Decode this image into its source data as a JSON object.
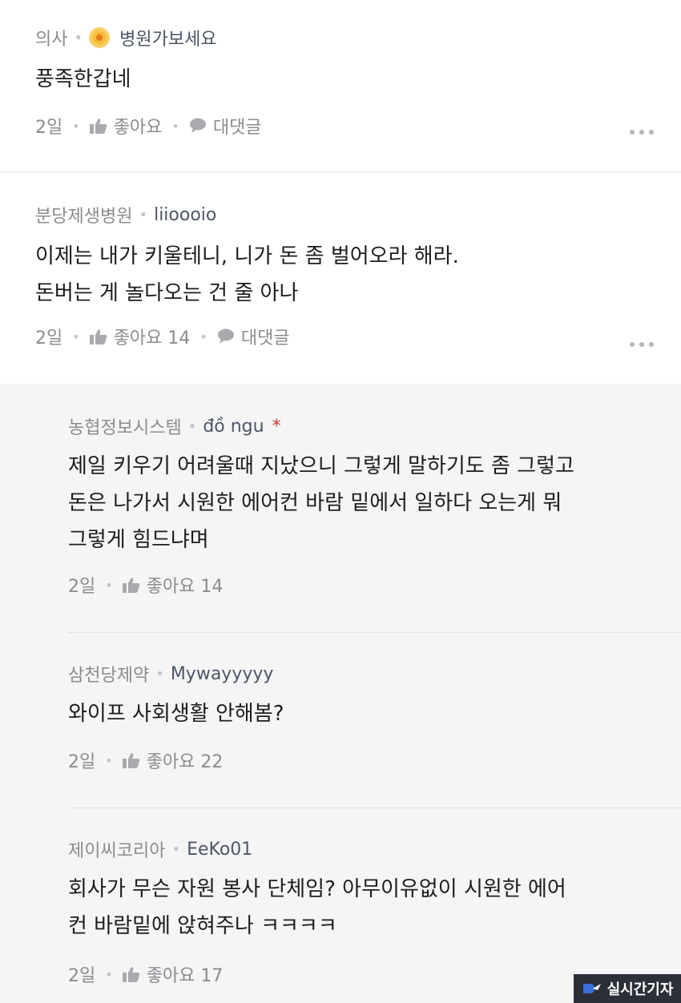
{
  "comments": [
    {
      "company": "의사",
      "nickname": "병원가보세요",
      "text_lines": [
        "풍족한갑네"
      ],
      "time": "2일",
      "like_label": "좋아요",
      "reply_label": "대댓글"
    },
    {
      "company": "분당제생병원",
      "nickname": "liioooio",
      "text_lines": [
        "이제는 내가 키울테니, 니가 돈 좀 벌어오라  해라.",
        "돈버는 게 놀다오는 건 줄 아나"
      ],
      "time": "2일",
      "like_label": "좋아요 14",
      "reply_label": "대댓글"
    }
  ],
  "replies": [
    {
      "company": "농협정보시스템",
      "nickname": "đồ ngu",
      "author_mark": "*",
      "text_lines": [
        "제일 키우기 어려울때 지났으니 그렇게 말하기도 좀 그렇고",
        "돈은 나가서 시원한 에어컨 바람 밑에서 일하다 오는게 뭐",
        "그렇게 힘드냐며"
      ],
      "time": "2일",
      "like_label": "좋아요 14"
    },
    {
      "company": "삼천당제약",
      "nickname": "Mywayyyyy",
      "text_lines": [
        "와이프 사회생활 안해봄?"
      ],
      "time": "2일",
      "like_label": "좋아요 22"
    },
    {
      "company": "제이씨코리아",
      "nickname": "EeKo01",
      "text_lines": [
        "회사가 무슨 자원 봉사 단체임? 아무이유없이 시원한 에어",
        "컨 바람밑에 앉혀주나 ㅋㅋㅋㅋ"
      ],
      "time": "2일",
      "like_label": "좋아요 17"
    }
  ],
  "icons": {
    "like": "thumbs-up-icon",
    "reply": "speech-bubble-icon",
    "more": "more-dots-icon",
    "badge": "sun-badge-icon"
  },
  "watermark": {
    "label": "실시간기자"
  },
  "colors": {
    "reply_background": "#f5f5f6",
    "author_mark": "#c0392b",
    "meta_text": "#8b8b90"
  }
}
